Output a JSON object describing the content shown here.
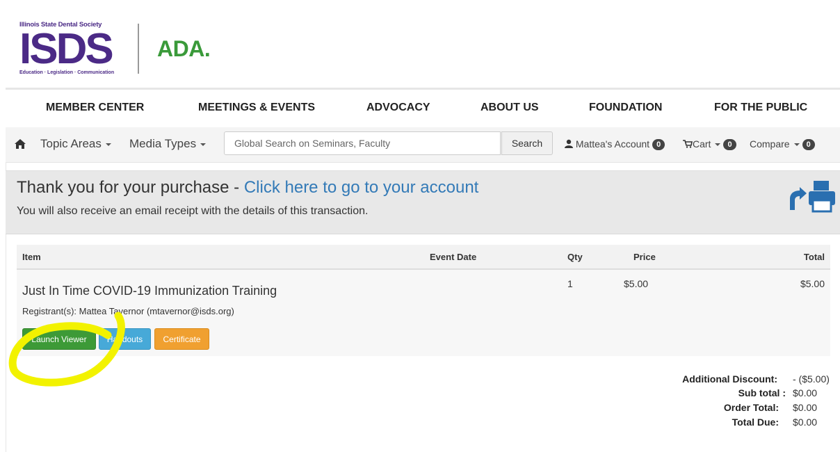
{
  "logo": {
    "isds_top": "Illinois State Dental Society",
    "isds_big": "ISDS",
    "isds_bottom": "Education · Legislation · Communication",
    "ada": "ADA."
  },
  "nav": {
    "items": [
      "MEMBER CENTER",
      "MEETINGS & EVENTS",
      "ADVOCACY",
      "ABOUT US",
      "FOUNDATION",
      "FOR THE PUBLIC"
    ]
  },
  "subbar": {
    "topic_areas": "Topic Areas",
    "media_types": "Media Types",
    "search_placeholder": "Global Search on Seminars, Faculty",
    "search_button": "Search",
    "account": "Mattea's Account",
    "account_count": "0",
    "cart": "Cart",
    "cart_count": "0",
    "compare": "Compare",
    "compare_count": "0"
  },
  "thankyou": {
    "title": "Thank you for your purchase - ",
    "link": "Click here to go to your account",
    "subtitle": "You will also receive an email receipt with the details of this transaction."
  },
  "table": {
    "headers": {
      "item": "Item",
      "event_date": "Event Date",
      "qty": "Qty",
      "price": "Price",
      "total": "Total"
    },
    "row": {
      "title": "Just In Time COVID-19 Immunization Training",
      "registrant": "Registrant(s): Mattea Tavernor (mtavernor@isds.org)",
      "qty": "1",
      "price": "$5.00",
      "total": "$5.00",
      "buttons": {
        "launch": "Launch Viewer",
        "handouts": "Handouts",
        "certificate": "Certificate"
      }
    }
  },
  "totals": {
    "discount_label": "Additional Discount:",
    "discount_value": "- ($5.00)",
    "subtotal_label": "Sub total :",
    "subtotal_value": "$0.00",
    "order_label": "Order Total:",
    "order_value": "$0.00",
    "due_label": "Total Due:",
    "due_value": "$0.00"
  },
  "colors": {
    "isds_purple": "#4b2a86",
    "ada_green": "#3a9a3a",
    "link_blue": "#337ab7",
    "launch_green": "#3d9a37",
    "handouts_blue": "#47a9d8",
    "certificate_orange": "#f0a030",
    "highlight_yellow": "#f2f200"
  },
  "icons": [
    "home-icon",
    "user-icon",
    "cart-icon",
    "back-arrow-icon",
    "print-icon"
  ]
}
